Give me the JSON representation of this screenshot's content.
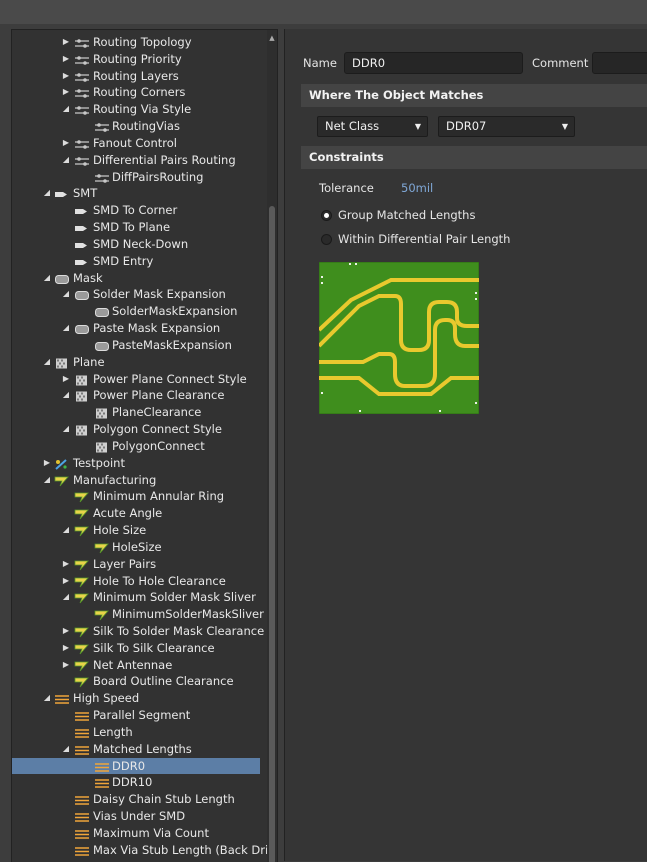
{
  "tree": [
    {
      "label": "Routing Topology",
      "level": 2,
      "toggle": "collapsed",
      "icon": "routing-icon"
    },
    {
      "label": "Routing Priority",
      "level": 2,
      "toggle": "collapsed",
      "icon": "routing-icon"
    },
    {
      "label": "Routing Layers",
      "level": 2,
      "toggle": "collapsed",
      "icon": "routing-icon"
    },
    {
      "label": "Routing Corners",
      "level": 2,
      "toggle": "collapsed",
      "icon": "routing-icon"
    },
    {
      "label": "Routing Via Style",
      "level": 2,
      "toggle": "expanded",
      "icon": "routing-icon"
    },
    {
      "label": "RoutingVias",
      "level": 3,
      "toggle": "none",
      "icon": "routing-icon"
    },
    {
      "label": "Fanout Control",
      "level": 2,
      "toggle": "collapsed",
      "icon": "routing-icon"
    },
    {
      "label": "Differential Pairs Routing",
      "level": 2,
      "toggle": "expanded",
      "icon": "routing-icon"
    },
    {
      "label": "DiffPairsRouting",
      "level": 3,
      "toggle": "none",
      "icon": "routing-icon"
    },
    {
      "label": "SMT",
      "level": 1,
      "toggle": "expanded",
      "icon": "smt-icon"
    },
    {
      "label": "SMD To Corner",
      "level": 2,
      "toggle": "none",
      "icon": "smt-icon"
    },
    {
      "label": "SMD To Plane",
      "level": 2,
      "toggle": "none",
      "icon": "smt-icon"
    },
    {
      "label": "SMD Neck-Down",
      "level": 2,
      "toggle": "none",
      "icon": "smt-icon"
    },
    {
      "label": "SMD Entry",
      "level": 2,
      "toggle": "none",
      "icon": "smt-icon"
    },
    {
      "label": "Mask",
      "level": 1,
      "toggle": "expanded",
      "icon": "mask-icon"
    },
    {
      "label": "Solder Mask Expansion",
      "level": 2,
      "toggle": "expanded",
      "icon": "mask-icon"
    },
    {
      "label": "SolderMaskExpansion",
      "level": 3,
      "toggle": "none",
      "icon": "mask-icon"
    },
    {
      "label": "Paste Mask Expansion",
      "level": 2,
      "toggle": "expanded",
      "icon": "mask-icon"
    },
    {
      "label": "PasteMaskExpansion",
      "level": 3,
      "toggle": "none",
      "icon": "mask-icon"
    },
    {
      "label": "Plane",
      "level": 1,
      "toggle": "expanded",
      "icon": "plane-icon"
    },
    {
      "label": "Power Plane Connect Style",
      "level": 2,
      "toggle": "collapsed",
      "icon": "plane-icon"
    },
    {
      "label": "Power Plane Clearance",
      "level": 2,
      "toggle": "expanded",
      "icon": "plane-icon"
    },
    {
      "label": "PlaneClearance",
      "level": 3,
      "toggle": "none",
      "icon": "plane-icon"
    },
    {
      "label": "Polygon Connect Style",
      "level": 2,
      "toggle": "expanded",
      "icon": "plane-icon"
    },
    {
      "label": "PolygonConnect",
      "level": 3,
      "toggle": "none",
      "icon": "plane-icon"
    },
    {
      "label": "Testpoint",
      "level": 1,
      "toggle": "collapsed",
      "icon": "testpoint-icon"
    },
    {
      "label": "Manufacturing",
      "level": 1,
      "toggle": "expanded",
      "icon": "manufacturing-icon"
    },
    {
      "label": "Minimum Annular Ring",
      "level": 2,
      "toggle": "none",
      "icon": "manufacturing-icon"
    },
    {
      "label": "Acute Angle",
      "level": 2,
      "toggle": "none",
      "icon": "manufacturing-icon"
    },
    {
      "label": "Hole Size",
      "level": 2,
      "toggle": "expanded",
      "icon": "manufacturing-icon"
    },
    {
      "label": "HoleSize",
      "level": 3,
      "toggle": "none",
      "icon": "manufacturing-icon"
    },
    {
      "label": "Layer Pairs",
      "level": 2,
      "toggle": "collapsed",
      "icon": "manufacturing-icon"
    },
    {
      "label": "Hole To Hole Clearance",
      "level": 2,
      "toggle": "collapsed",
      "icon": "manufacturing-icon"
    },
    {
      "label": "Minimum Solder Mask Sliver",
      "level": 2,
      "toggle": "expanded",
      "icon": "manufacturing-icon"
    },
    {
      "label": "MinimumSolderMaskSliver",
      "level": 3,
      "toggle": "none",
      "icon": "manufacturing-icon"
    },
    {
      "label": "Silk To Solder Mask Clearance",
      "level": 2,
      "toggle": "collapsed",
      "icon": "manufacturing-icon"
    },
    {
      "label": "Silk To Silk Clearance",
      "level": 2,
      "toggle": "collapsed",
      "icon": "manufacturing-icon"
    },
    {
      "label": "Net Antennae",
      "level": 2,
      "toggle": "collapsed",
      "icon": "manufacturing-icon"
    },
    {
      "label": "Board Outline Clearance",
      "level": 2,
      "toggle": "none",
      "icon": "manufacturing-icon"
    },
    {
      "label": "High Speed",
      "level": 1,
      "toggle": "expanded",
      "icon": "high-speed-icon"
    },
    {
      "label": "Parallel Segment",
      "level": 2,
      "toggle": "none",
      "icon": "high-speed-icon"
    },
    {
      "label": "Length",
      "level": 2,
      "toggle": "none",
      "icon": "high-speed-icon"
    },
    {
      "label": "Matched Lengths",
      "level": 2,
      "toggle": "expanded",
      "icon": "high-speed-icon"
    },
    {
      "label": "DDR0",
      "level": 3,
      "toggle": "none",
      "icon": "high-speed-icon",
      "selected": true
    },
    {
      "label": "DDR10",
      "level": 3,
      "toggle": "none",
      "icon": "high-speed-icon"
    },
    {
      "label": "Daisy Chain Stub Length",
      "level": 2,
      "toggle": "none",
      "icon": "high-speed-icon"
    },
    {
      "label": "Vias Under SMD",
      "level": 2,
      "toggle": "none",
      "icon": "high-speed-icon"
    },
    {
      "label": "Maximum Via Count",
      "level": 2,
      "toggle": "none",
      "icon": "high-speed-icon"
    },
    {
      "label": "Max Via Stub Length (Back Dril",
      "level": 2,
      "toggle": "none",
      "icon": "high-speed-icon"
    }
  ],
  "rule": {
    "name_label": "Name",
    "name_value": "DDR0",
    "comment_label": "Comment",
    "comment_value": ""
  },
  "scope": {
    "header": "Where The Object Matches",
    "type_value": "Net Class",
    "object_value": "DDR07"
  },
  "constraints": {
    "header": "Constraints",
    "tolerance_label": "Tolerance",
    "tolerance_value": "50mil",
    "options": [
      {
        "label": "Group Matched Lengths",
        "checked": true
      },
      {
        "label": "Within Differential Pair Length",
        "checked": false
      }
    ]
  },
  "colors": {
    "selection": "#5c7ea6",
    "tolerance_value": "#7fa7d6",
    "board_green": "#3f8e1d",
    "trace_yellow": "#e8c92e"
  }
}
